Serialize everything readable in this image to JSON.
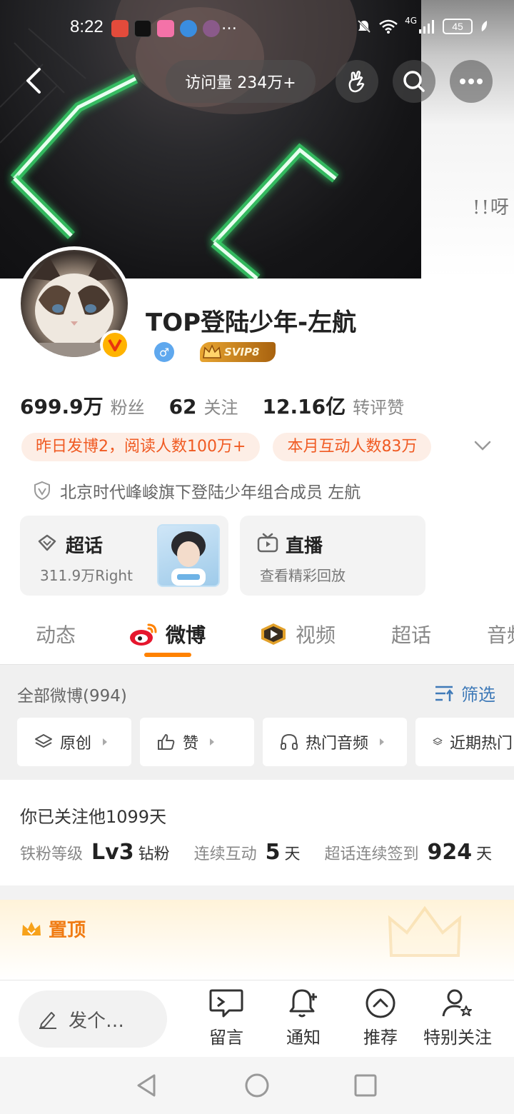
{
  "status_bar": {
    "time": "8:22",
    "more": "…",
    "network": "4G",
    "battery": "45"
  },
  "header": {
    "visits": "访问量 234万+"
  },
  "profile": {
    "name": "TOP登陆少年-左航",
    "gender_symbol": "♂",
    "vip_badge": "SVIP8",
    "stats": [
      {
        "value": "699.9万",
        "label": "粉丝"
      },
      {
        "value": "62",
        "label": "关注"
      },
      {
        "value": "12.16亿",
        "label": "转评赞"
      }
    ],
    "tags": [
      "昨日发博2，阅读人数100万+",
      "本月互动人数83万"
    ],
    "description": "北京时代峰峻旗下登陆少年组合成员 左航"
  },
  "features": {
    "super_topic": {
      "title": "超话",
      "subtitle": "311.9万Right"
    },
    "live": {
      "title": "直播",
      "subtitle": "查看精彩回放"
    }
  },
  "tabs": [
    {
      "label": "动态"
    },
    {
      "label": "微博",
      "active": true
    },
    {
      "label": "视频"
    },
    {
      "label": "超话"
    },
    {
      "label": "音频"
    }
  ],
  "feed": {
    "all_posts": "全部微博(994)",
    "filter_label": "筛选",
    "chips": [
      "原创",
      "赞",
      "热门音频",
      "近期热门"
    ]
  },
  "follow": {
    "days_text": "你已关注他1099天",
    "fan_level_label": "铁粉等级",
    "fan_level_value": "Lv3",
    "fan_level_unit": "钻粉",
    "streak_label": "连续互动",
    "streak_value": "5",
    "streak_unit": "天",
    "checkin_label": "超话连续签到",
    "checkin_value": "924",
    "checkin_unit": "天"
  },
  "pinned": {
    "label": "置顶"
  },
  "bottom_bar": {
    "compose": "发个…",
    "items": [
      "留言",
      "通知",
      "推荐",
      "特别关注"
    ]
  },
  "colors": {
    "accent": "#ff8200",
    "tag_text": "#f05a22",
    "tag_bg": "#fdeee6",
    "link_blue": "#3f7ab8"
  },
  "icons": {
    "back": "chevron-left-icon",
    "shake": "hand-icon",
    "search": "search-icon",
    "more": "more-dots-icon"
  }
}
